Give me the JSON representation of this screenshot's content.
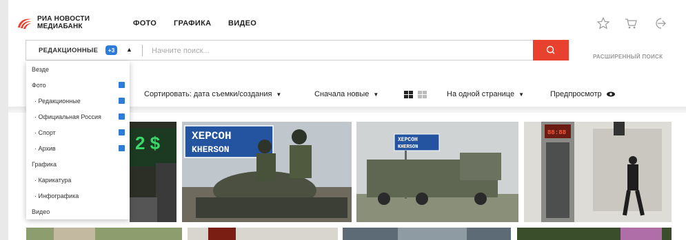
{
  "brand": {
    "line1": "РИА НОВОСТИ",
    "line2": "МЕДИАБАНК",
    "color": "#e8412f"
  },
  "nav": [
    "ФОТО",
    "ГРАФИКА",
    "ВИДЕО"
  ],
  "header_icons": [
    "star-icon",
    "cart-icon",
    "logout-icon"
  ],
  "search": {
    "filter_label": "РЕДАКЦИОННЫЕ",
    "filter_badge": "+3",
    "placeholder": "Начните поиск...",
    "button_icon": "search-icon",
    "advanced_label": "РАСШИРЕННЫЙ ПОИСК"
  },
  "dropdown": {
    "items": [
      {
        "label": "Везде",
        "indent": false,
        "checked": false
      },
      {
        "label": "Фото",
        "indent": false,
        "checked": true
      },
      {
        "label": "· Редакционные",
        "indent": true,
        "checked": true
      },
      {
        "label": "· Официальная Россия",
        "indent": true,
        "checked": true
      },
      {
        "label": "· Спорт",
        "indent": true,
        "checked": true
      },
      {
        "label": "· Архив",
        "indent": true,
        "checked": true
      },
      {
        "label": "Графика",
        "indent": false,
        "checked": false
      },
      {
        "label": "· Карикатура",
        "indent": true,
        "checked": false
      },
      {
        "label": "· Инфографика",
        "indent": true,
        "checked": false
      },
      {
        "label": "Видео",
        "indent": false,
        "checked": false
      }
    ]
  },
  "sortbar": {
    "sort_label": "Сортировать: дата съемки/создания",
    "order_label": "Сначала новые",
    "per_page_label": "На одной странице",
    "preview_label": "Предпросмотр"
  },
  "photos": [
    {
      "sign_line1": "ХЕРСОН",
      "sign_line2": "KHERSON"
    },
    {
      "sign_line1": "ХЕРСОН",
      "sign_line2": "KHERSON"
    }
  ]
}
